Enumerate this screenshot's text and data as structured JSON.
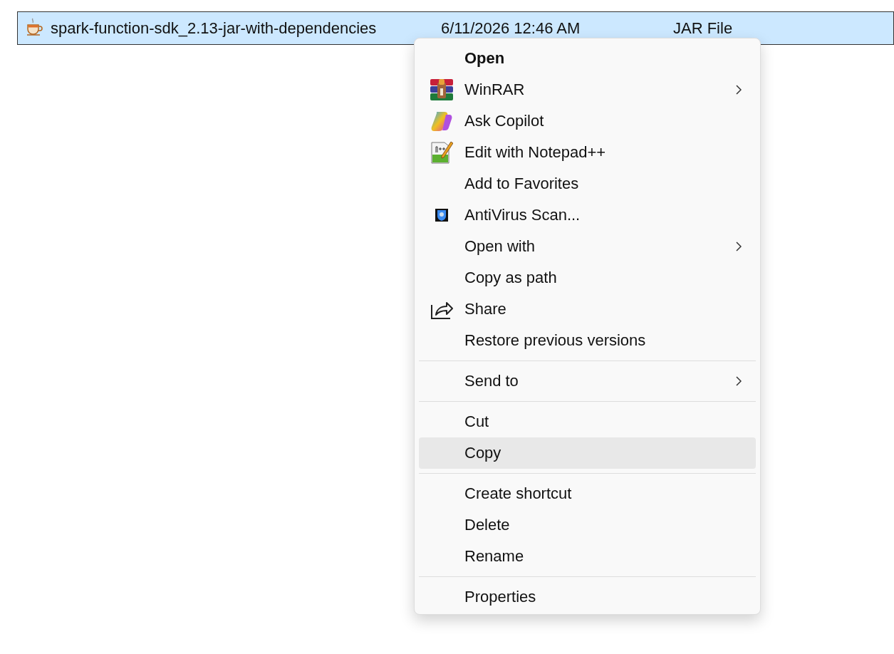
{
  "file_row": {
    "name": "spark-function-sdk_2.13-jar-with-dependencies",
    "date": "6/11/2026 12:46 AM",
    "type": "JAR File",
    "selected": true
  },
  "context_menu": {
    "items": [
      {
        "kind": "item",
        "label": "Open",
        "default": true,
        "hovered": false,
        "submenu": false
      },
      {
        "kind": "item",
        "label": "WinRAR",
        "default": false,
        "hovered": false,
        "submenu": true
      },
      {
        "kind": "item",
        "label": "Ask Copilot",
        "default": false,
        "hovered": false,
        "submenu": false
      },
      {
        "kind": "item",
        "label": "Edit with Notepad++",
        "default": false,
        "hovered": false,
        "submenu": false
      },
      {
        "kind": "item",
        "label": "Add to Favorites",
        "default": false,
        "hovered": false,
        "submenu": false
      },
      {
        "kind": "item",
        "label": "AntiVirus Scan...",
        "default": false,
        "hovered": false,
        "submenu": false
      },
      {
        "kind": "item",
        "label": "Open with",
        "default": false,
        "hovered": false,
        "submenu": true
      },
      {
        "kind": "item",
        "label": "Copy as path",
        "default": false,
        "hovered": false,
        "submenu": false
      },
      {
        "kind": "item",
        "label": "Share",
        "default": false,
        "hovered": false,
        "submenu": false
      },
      {
        "kind": "item",
        "label": "Restore previous versions",
        "default": false,
        "hovered": false,
        "submenu": false
      },
      {
        "kind": "separator"
      },
      {
        "kind": "item",
        "label": "Send to",
        "default": false,
        "hovered": false,
        "submenu": true
      },
      {
        "kind": "separator"
      },
      {
        "kind": "item",
        "label": "Cut",
        "default": false,
        "hovered": false,
        "submenu": false
      },
      {
        "kind": "item",
        "label": "Copy",
        "default": false,
        "hovered": true,
        "submenu": false
      },
      {
        "kind": "separator"
      },
      {
        "kind": "item",
        "label": "Create shortcut",
        "default": false,
        "hovered": false,
        "submenu": false
      },
      {
        "kind": "item",
        "label": "Delete",
        "default": false,
        "hovered": false,
        "submenu": false
      },
      {
        "kind": "item",
        "label": "Rename",
        "default": false,
        "hovered": false,
        "submenu": false
      },
      {
        "kind": "separator"
      },
      {
        "kind": "item",
        "label": "Properties",
        "default": false,
        "hovered": false,
        "submenu": false
      }
    ]
  }
}
